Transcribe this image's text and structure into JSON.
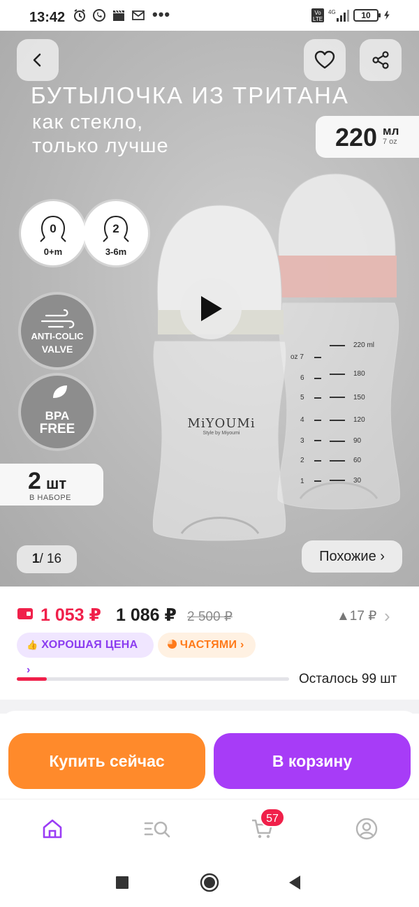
{
  "status_bar": {
    "time": "13:42",
    "network": "4G",
    "volte": "Vo LTE",
    "battery": "10",
    "more": "•••"
  },
  "hero": {
    "title": "БУТЫЛОЧКА ИЗ ТРИТАНА",
    "subtitle_line1": "как стекло,",
    "subtitle_line2": "только лучше",
    "volume_value": "220",
    "volume_unit": "мл",
    "volume_oz": "7 oz",
    "nipple_a_num": "0",
    "nipple_a_age": "0+m",
    "nipple_b_num": "2",
    "nipple_b_age": "3-6m",
    "anticolic_line1": "ANTI-COLIC",
    "anticolic_line2": "VALVE",
    "bpa_line1": "BPA",
    "bpa_line2": "FREE",
    "pcs_value": "2",
    "pcs_unit": "шт",
    "pcs_set": "В НАБОРЕ",
    "brand": "MiYOUMi",
    "brand_tag": "Style by Miyoumi",
    "scale_top": "220 ml",
    "scale_oz": "oz 7",
    "scale_left": [
      "6",
      "5",
      "4",
      "3",
      "2",
      "1"
    ],
    "scale_right": [
      "180",
      "150",
      "120",
      "90",
      "60",
      "30"
    ],
    "counter_current": "1",
    "counter_total": "/ 16",
    "similar_label": "Похожие ›"
  },
  "price": {
    "card_price": "1 053 ₽",
    "price": "1 086 ₽",
    "old_price": "2 500 ₽",
    "change": "▲17 ₽",
    "good_price_chip": "ХОРОШАЯ ЦЕНА ›",
    "installments_chip": "ЧАСТЯМИ ›",
    "stock_text": "Осталось 99 шт",
    "stock_fraction": 0.11
  },
  "actions": {
    "buy_now": "Купить сейчас",
    "add_to_cart": "В корзину"
  },
  "tabbar": {
    "cart_badge": "57"
  },
  "colors": {
    "accent_purple": "#a73cf7",
    "accent_orange": "#ff8a2b",
    "price_red": "#f0204a"
  }
}
